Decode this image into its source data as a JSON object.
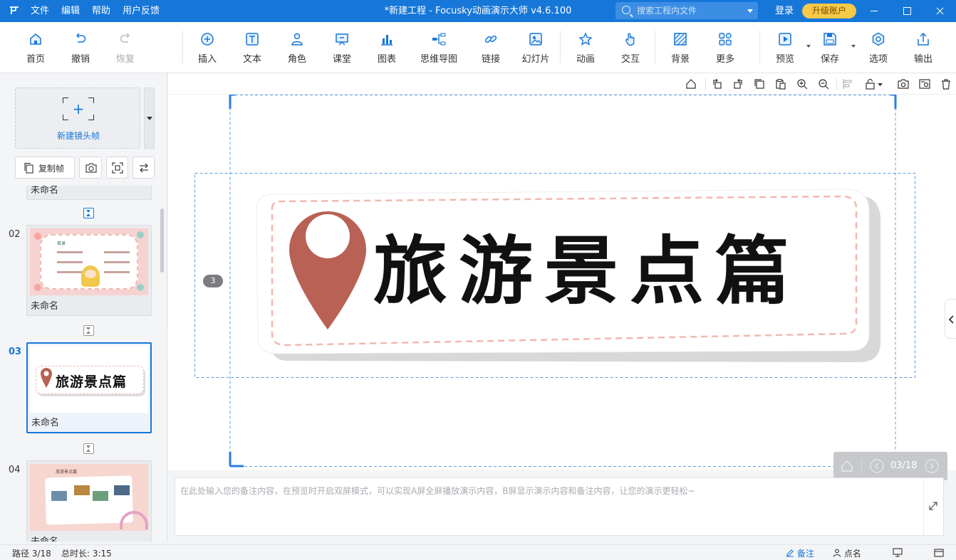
{
  "titlebar": {
    "title": "*新建工程 - Focusky动画演示大师  v4.6.100",
    "menu": [
      "文件",
      "编辑",
      "帮助",
      "用户反馈"
    ],
    "search_placeholder": "搜索工程内文件",
    "login": "登录",
    "upgrade": "升级账户"
  },
  "toolbar": {
    "items": [
      {
        "label": "首页",
        "icon": "home-icon"
      },
      {
        "label": "撤销",
        "icon": "undo-icon"
      },
      {
        "label": "恢复",
        "icon": "redo-icon"
      },
      {
        "label": "插入",
        "icon": "plus-circle-icon"
      },
      {
        "label": "文本",
        "icon": "text-icon"
      },
      {
        "label": "角色",
        "icon": "character-icon"
      },
      {
        "label": "课堂",
        "icon": "classroom-icon"
      },
      {
        "label": "图表",
        "icon": "chart-icon"
      },
      {
        "label": "思维导图",
        "icon": "mindmap-icon"
      },
      {
        "label": "链接",
        "icon": "link-icon"
      },
      {
        "label": "幻灯片",
        "icon": "slide-icon"
      },
      {
        "label": "动画",
        "icon": "star-icon"
      },
      {
        "label": "交互",
        "icon": "hand-icon"
      },
      {
        "label": "背景",
        "icon": "background-icon"
      },
      {
        "label": "更多",
        "icon": "more-icon"
      },
      {
        "label": "预览",
        "icon": "preview-icon"
      },
      {
        "label": "保存",
        "icon": "save-icon"
      },
      {
        "label": "选项",
        "icon": "options-icon"
      },
      {
        "label": "输出",
        "icon": "export-icon"
      }
    ]
  },
  "leftpanel": {
    "new_frame_label": "新建镜头帧",
    "copy_frame_label": "复制帧",
    "partial_label": "未命名",
    "slides": [
      {
        "no": "02",
        "name": "未命名",
        "active": false
      },
      {
        "no": "03",
        "name": "未命名",
        "active": true
      },
      {
        "no": "04",
        "name": "未命名",
        "active": false
      }
    ],
    "thumb02_texts": [
      "目录"
    ],
    "thumb03_text": "旅游景点篇",
    "thumb04_text": "旅游景点篇"
  },
  "canvas": {
    "slide_title": "旅游景点篇",
    "path_badge": "3",
    "nav_counter": "03/18",
    "accent": "#1677d9",
    "pin_color": "#b86154",
    "dash_color": "#f2b8b0"
  },
  "notes": {
    "placeholder": "在此处输入您的备注内容，在预览时开启双屏模式，可以实现A屏全屏播放演示内容，B屏显示演示内容和备注内容，让您的演示更轻松~"
  },
  "statusbar": {
    "path": "路径 3/18",
    "duration": "总时长: 3:15",
    "notes_label": "备注",
    "rollcall_label": "点名"
  }
}
